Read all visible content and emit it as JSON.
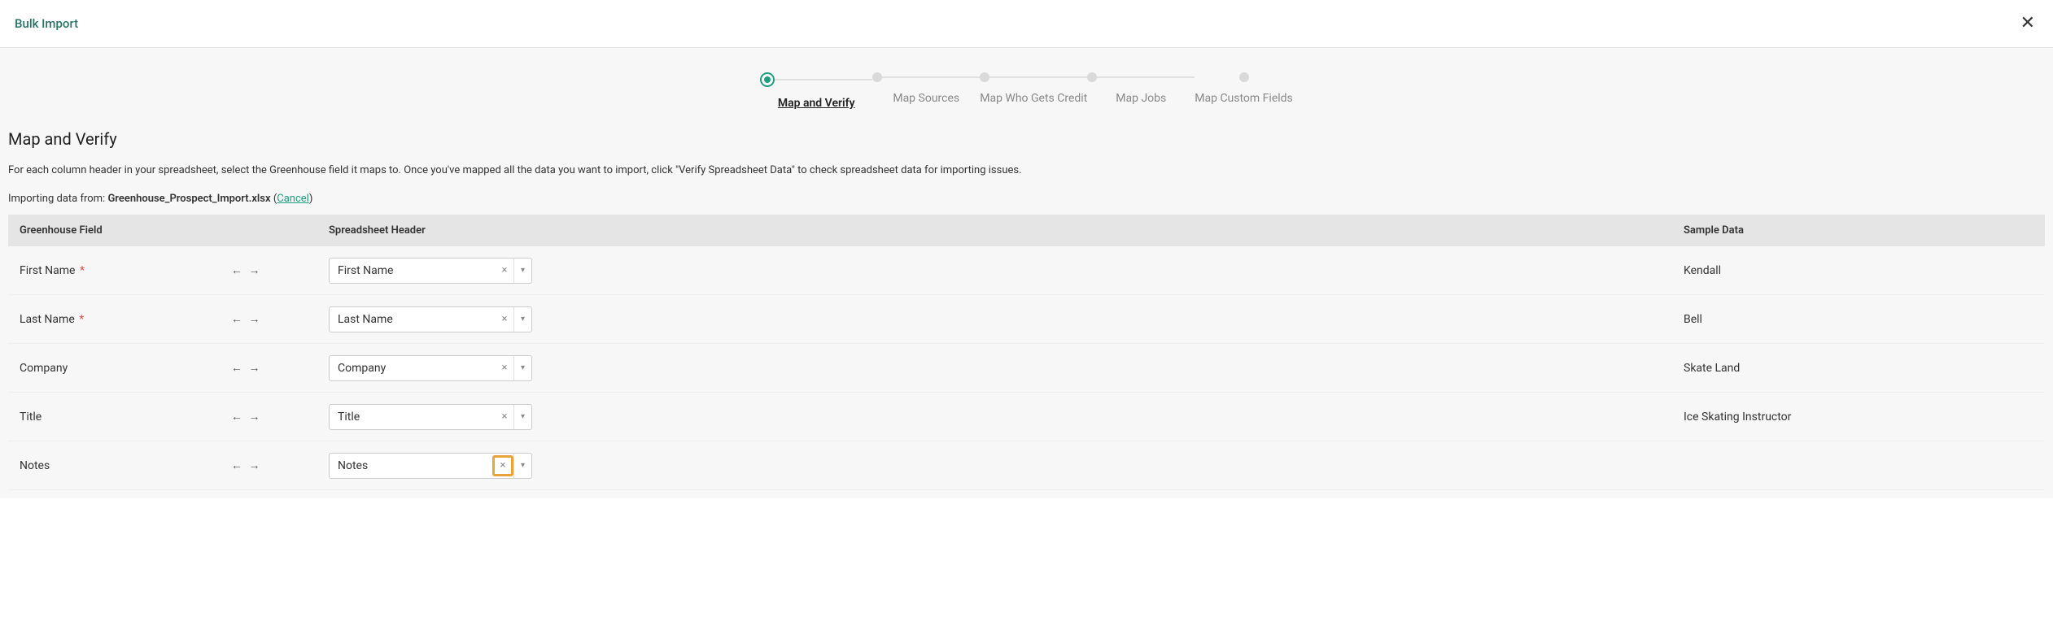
{
  "header": {
    "title": "Bulk Import"
  },
  "stepper": {
    "steps": [
      {
        "label": "Map and Verify",
        "active": true
      },
      {
        "label": "Map Sources",
        "active": false
      },
      {
        "label": "Map Who Gets Credit",
        "active": false
      },
      {
        "label": "Map Jobs",
        "active": false
      },
      {
        "label": "Map Custom Fields",
        "active": false
      }
    ]
  },
  "page": {
    "heading": "Map and Verify",
    "instruction": "For each column header in your spreadsheet, select the Greenhouse field it maps to. Once you've mapped all the data you want to import, click \"Verify Spreadsheet Data\" to check spreadsheet data for importing issues.",
    "importing_prefix": "Importing data from: ",
    "importing_file": "Greenhouse_Prospect_Import.xlsx",
    "cancel_label": "Cancel"
  },
  "table": {
    "headers": {
      "field": "Greenhouse Field",
      "header": "Spreadsheet Header",
      "sample": "Sample Data"
    },
    "arrow_glyph": "←  →",
    "rows": [
      {
        "field": "First Name",
        "required": true,
        "header_value": "First Name",
        "sample": "Kendall",
        "highlight_clear": false
      },
      {
        "field": "Last Name",
        "required": true,
        "header_value": "Last Name",
        "sample": "Bell",
        "highlight_clear": false
      },
      {
        "field": "Company",
        "required": false,
        "header_value": "Company",
        "sample": "Skate Land",
        "highlight_clear": false
      },
      {
        "field": "Title",
        "required": false,
        "header_value": "Title",
        "sample": "Ice Skating Instructor",
        "highlight_clear": false
      },
      {
        "field": "Notes",
        "required": false,
        "header_value": "Notes",
        "sample": "",
        "highlight_clear": true
      }
    ]
  }
}
